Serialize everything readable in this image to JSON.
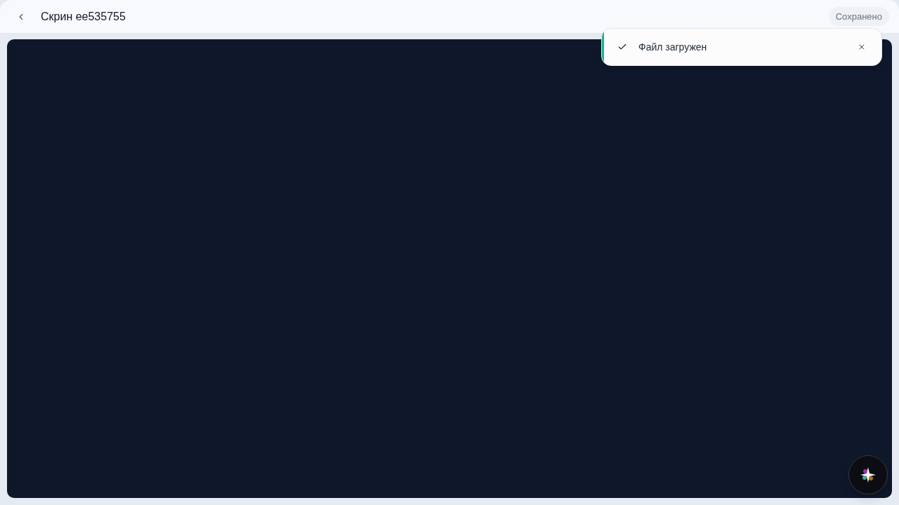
{
  "header": {
    "title": "Скрин ee535755",
    "status_badge": "Сохранено"
  },
  "toast": {
    "kind": "success",
    "message": "Файл загружен"
  }
}
